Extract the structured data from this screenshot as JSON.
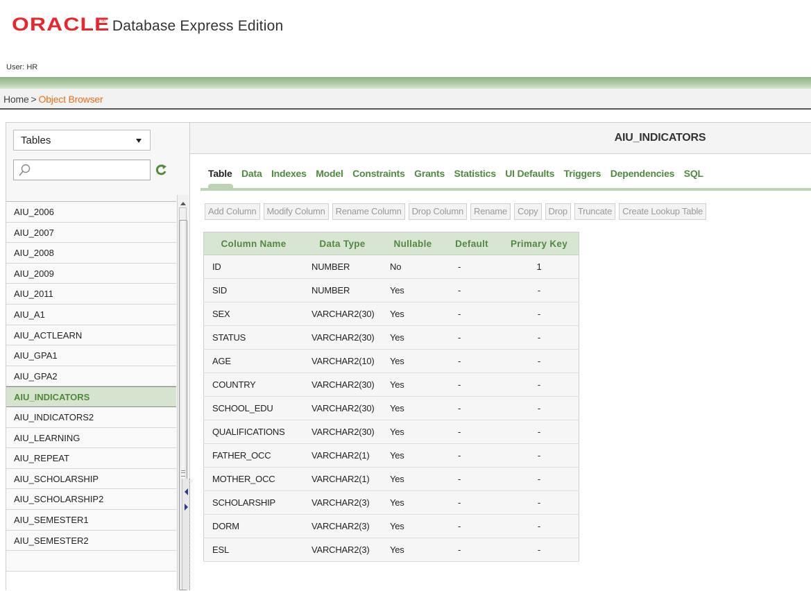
{
  "header": {
    "brand": "ORACLE",
    "brand_mark": "®",
    "product": "Database Express Edition",
    "user_label": "User: HR"
  },
  "breadcrumb": {
    "home": "Home",
    "separator": ">",
    "current": "Object Browser"
  },
  "object_browser": {
    "object_type": "Tables",
    "search_value": "",
    "items": [
      {
        "label": "AIU_2006"
      },
      {
        "label": "AIU_2007"
      },
      {
        "label": "AIU_2008"
      },
      {
        "label": "AIU_2009"
      },
      {
        "label": "AIU_2011"
      },
      {
        "label": "AIU_A1"
      },
      {
        "label": "AIU_ACTLEARN"
      },
      {
        "label": "AIU_GPA1"
      },
      {
        "label": "AIU_GPA2"
      },
      {
        "label": "AIU_INDICATORS"
      },
      {
        "label": "AIU_INDICATORS2"
      },
      {
        "label": "AIU_LEARNING"
      },
      {
        "label": "AIU_REPEAT"
      },
      {
        "label": "AIU_SCHOLARSHIP"
      },
      {
        "label": "AIU_SCHOLARSHIP2"
      },
      {
        "label": "AIU_SEMESTER1"
      },
      {
        "label": "AIU_SEMESTER2"
      },
      {
        "label": ""
      }
    ],
    "selected_item": "AIU_INDICATORS"
  },
  "detail": {
    "title": "AIU_INDICATORS",
    "tabs": [
      {
        "label": "Table"
      },
      {
        "label": "Data"
      },
      {
        "label": "Indexes"
      },
      {
        "label": "Model"
      },
      {
        "label": "Constraints"
      },
      {
        "label": "Grants"
      },
      {
        "label": "Statistics"
      },
      {
        "label": "UI Defaults"
      },
      {
        "label": "Triggers"
      },
      {
        "label": "Dependencies"
      },
      {
        "label": "SQL"
      }
    ],
    "active_tab": "Table",
    "toolbar": [
      {
        "label": "Add Column"
      },
      {
        "label": "Modify Column"
      },
      {
        "label": "Rename Column"
      },
      {
        "label": "Drop Column"
      },
      {
        "label": "Rename"
      },
      {
        "label": "Copy"
      },
      {
        "label": "Drop"
      },
      {
        "label": "Truncate"
      },
      {
        "label": "Create Lookup Table"
      }
    ],
    "columns_headers": {
      "name": "Column Name",
      "type": "Data Type",
      "nullable": "Nullable",
      "default": "Default",
      "pk": "Primary Key"
    },
    "rows": [
      {
        "name": "ID",
        "type": "NUMBER",
        "nullable": "No",
        "default": "-",
        "pk": "1"
      },
      {
        "name": "SID",
        "type": "NUMBER",
        "nullable": "Yes",
        "default": "-",
        "pk": "-"
      },
      {
        "name": "SEX",
        "type": "VARCHAR2(30)",
        "nullable": "Yes",
        "default": "-",
        "pk": "-"
      },
      {
        "name": "STATUS",
        "type": "VARCHAR2(30)",
        "nullable": "Yes",
        "default": "-",
        "pk": "-"
      },
      {
        "name": "AGE",
        "type": "VARCHAR2(10)",
        "nullable": "Yes",
        "default": "-",
        "pk": "-"
      },
      {
        "name": "COUNTRY",
        "type": "VARCHAR2(30)",
        "nullable": "Yes",
        "default": "-",
        "pk": "-"
      },
      {
        "name": "SCHOOL_EDU",
        "type": "VARCHAR2(30)",
        "nullable": "Yes",
        "default": "-",
        "pk": "-"
      },
      {
        "name": "QUALIFICATIONS",
        "type": "VARCHAR2(30)",
        "nullable": "Yes",
        "default": "-",
        "pk": "-"
      },
      {
        "name": "FATHER_OCC",
        "type": "VARCHAR2(1)",
        "nullable": "Yes",
        "default": "-",
        "pk": "-"
      },
      {
        "name": "MOTHER_OCC",
        "type": "VARCHAR2(1)",
        "nullable": "Yes",
        "default": "-",
        "pk": "-"
      },
      {
        "name": "SCHOLARSHIP",
        "type": "VARCHAR2(3)",
        "nullable": "Yes",
        "default": "-",
        "pk": "-"
      },
      {
        "name": "DORM",
        "type": "VARCHAR2(3)",
        "nullable": "Yes",
        "default": "-",
        "pk": "-"
      },
      {
        "name": "ESL",
        "type": "VARCHAR2(3)",
        "nullable": "Yes",
        "default": "-",
        "pk": "-"
      }
    ]
  },
  "colors": {
    "brand_red": "#e8262b",
    "accent_green": "#4f8a3f",
    "breadcrumb_orange": "#e8701a"
  }
}
